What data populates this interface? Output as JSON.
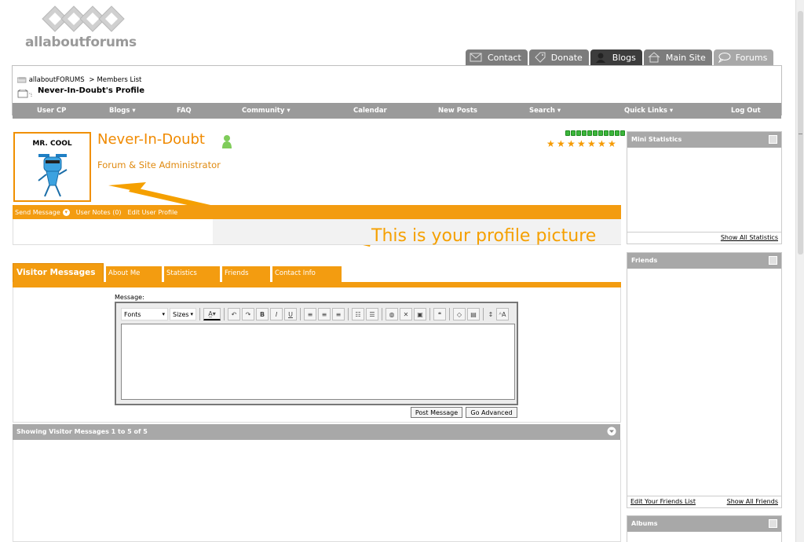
{
  "logo": {
    "text": "allaboutforums"
  },
  "top_tabs": [
    {
      "label": "Contact",
      "icon": "envelope-icon"
    },
    {
      "label": "Donate",
      "icon": "tag-icon"
    },
    {
      "label": "Blogs",
      "icon": "person-icon"
    },
    {
      "label": "Main Site",
      "icon": "house-icon"
    },
    {
      "label": "Forums",
      "icon": "speech-bubble-icon"
    }
  ],
  "breadcrumb": {
    "root": "allaboutFORUMS",
    "sep": ">",
    "item": "Members List",
    "title": "Never-In-Doubt's Profile"
  },
  "nav": [
    "User CP",
    "Blogs",
    "FAQ",
    "Community",
    "Calendar",
    "New Posts",
    "Search",
    "Quick Links",
    "Log Out"
  ],
  "nav_dropdowns": [
    "Blogs",
    "Community",
    "Search",
    "Quick Links"
  ],
  "profile": {
    "avatar_caption": "MR. COOL",
    "username": "Never-In-Doubt",
    "user_title": "Forum & Site Administrator",
    "reputation_segments": 11,
    "stars": 7
  },
  "actions": {
    "send_message": "Send Message",
    "user_notes": "User Notes (0)",
    "edit_profile": "Edit User Profile"
  },
  "annotation": "This is your profile picture",
  "tabs": [
    {
      "label": "Visitor Messages",
      "active": true
    },
    {
      "label": "About Me",
      "active": false
    },
    {
      "label": "Statistics",
      "active": false
    },
    {
      "label": "Friends",
      "active": false
    },
    {
      "label": "Contact Info",
      "active": false
    }
  ],
  "editor": {
    "label": "Message:",
    "font_select": "Fonts",
    "size_select": "Sizes",
    "post_button": "Post Message",
    "advanced_button": "Go Advanced"
  },
  "showing": "Showing Visitor Messages 1 to 5 of 5",
  "sidebar": {
    "mini_stats": {
      "title": "Mini Statistics",
      "link": "Show All Statistics"
    },
    "friends": {
      "title": "Friends",
      "link_left": "Edit Your Friends List",
      "link_right": "Show All Friends"
    },
    "albums": {
      "title": "Albums"
    }
  },
  "colors": {
    "accent": "#f39c10",
    "nav_gray": "#9a9a9a",
    "header_gray": "#a8a8a8",
    "rep_green": "#3cb63c"
  }
}
